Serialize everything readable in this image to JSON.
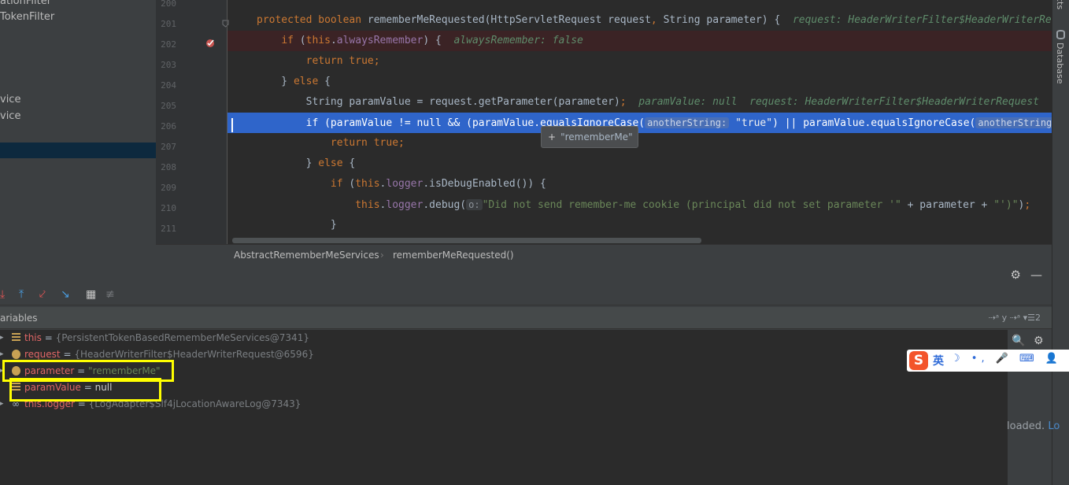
{
  "project_tree": {
    "items": [
      "ationFilter",
      "TokenFilter",
      "vice",
      "vice"
    ]
  },
  "editor": {
    "lines": [
      {
        "num": "200"
      },
      {
        "num": "201",
        "parts": [
          {
            "t": "protected boolean ",
            "c": "kw"
          },
          {
            "t": "rememberMeRequested(HttpServletRequest request",
            "c": ""
          },
          {
            "t": ", ",
            "c": "kw"
          },
          {
            "t": "String parameter) {  ",
            "c": ""
          },
          {
            "t": "request: HeaderWriterFilter$HeaderWriterRequest",
            "c": "hint"
          }
        ]
      },
      {
        "num": "202",
        "parts": [
          {
            "t": "    ",
            "c": ""
          },
          {
            "t": "if ",
            "c": "kw"
          },
          {
            "t": "(",
            "c": ""
          },
          {
            "t": "this",
            "c": "kw"
          },
          {
            "t": ".",
            "c": ""
          },
          {
            "t": "alwaysRemember",
            "c": "fld"
          },
          {
            "t": ") {  ",
            "c": ""
          },
          {
            "t": "alwaysRemember: false",
            "c": "hint"
          }
        ]
      },
      {
        "num": "203",
        "parts": [
          {
            "t": "        ",
            "c": ""
          },
          {
            "t": "return true",
            "c": "kw"
          },
          {
            "t": ";",
            "c": "kw"
          }
        ]
      },
      {
        "num": "204",
        "parts": [
          {
            "t": "    } ",
            "c": ""
          },
          {
            "t": "else ",
            "c": "kw"
          },
          {
            "t": "{",
            "c": ""
          }
        ]
      },
      {
        "num": "205",
        "parts": [
          {
            "t": "        String paramValue = request.getParameter(parameter)",
            "c": ""
          },
          {
            "t": ";  ",
            "c": "kw"
          },
          {
            "t": "paramValue: null  request: HeaderWriterFilter$HeaderWriterRequest",
            "c": "hint"
          }
        ]
      },
      {
        "num": "206",
        "parts": [
          {
            "t": "        ",
            "c": ""
          },
          {
            "t": "if ",
            "c": "kw"
          },
          {
            "t": "(paramValue != ",
            "c": ""
          },
          {
            "t": "null ",
            "c": "kw"
          },
          {
            "t": "&& (paramValue.equalsIgnoreCase(",
            "c": ""
          },
          {
            "t": "anotherString:",
            "c": "hint-inline"
          },
          {
            "t": " ",
            "c": ""
          },
          {
            "t": "\"true\"",
            "c": "str"
          },
          {
            "t": ") || paramValue.equalsIgnoreCase(",
            "c": ""
          },
          {
            "t": "anotherString:",
            "c": "hint-inline"
          }
        ]
      },
      {
        "num": "207",
        "parts": [
          {
            "t": "            ",
            "c": ""
          },
          {
            "t": "return true",
            "c": "kw"
          },
          {
            "t": ";",
            "c": "kw"
          }
        ]
      },
      {
        "num": "208",
        "parts": [
          {
            "t": "        } ",
            "c": ""
          },
          {
            "t": "else ",
            "c": "kw"
          },
          {
            "t": "{",
            "c": ""
          }
        ]
      },
      {
        "num": "209",
        "parts": [
          {
            "t": "            ",
            "c": ""
          },
          {
            "t": "if ",
            "c": "kw"
          },
          {
            "t": "(",
            "c": ""
          },
          {
            "t": "this",
            "c": "kw"
          },
          {
            "t": ".",
            "c": ""
          },
          {
            "t": "logger",
            "c": "fld"
          },
          {
            "t": ".isDebugEnabled()) {",
            "c": ""
          }
        ]
      },
      {
        "num": "210",
        "parts": [
          {
            "t": "                ",
            "c": ""
          },
          {
            "t": "this",
            "c": "kw"
          },
          {
            "t": ".",
            "c": ""
          },
          {
            "t": "logger",
            "c": "fld"
          },
          {
            "t": ".debug(",
            "c": ""
          },
          {
            "t": "o:",
            "c": "hint-inline"
          },
          {
            "t": "\"Did not send remember-me cookie (principal did not set parameter '\" ",
            "c": "str"
          },
          {
            "t": "+ parameter + ",
            "c": ""
          },
          {
            "t": "\"')\"",
            "c": "str"
          },
          {
            "t": ")",
            "c": ""
          },
          {
            "t": ";",
            "c": "kw"
          }
        ]
      },
      {
        "num": "211",
        "parts": [
          {
            "t": "            }",
            "c": ""
          }
        ]
      }
    ],
    "popup": {
      "plus": "+",
      "value": "\"rememberMe\""
    }
  },
  "breadcrumb": {
    "class_name": "AbstractRememberMeServices",
    "separator": "›",
    "method_name": "rememberMeRequested()"
  },
  "right_strip": {
    "top_label": "cts",
    "database_label": "Database"
  },
  "debug": {
    "header_icons": {
      "settings": "⚙",
      "minimize": "—"
    },
    "toolbar_icons": [
      {
        "name": "step-into-icon",
        "glyph": "⤓",
        "color": "#e05555"
      },
      {
        "name": "step-out-icon",
        "glyph": "⤒",
        "color": "#4a9de0"
      },
      {
        "name": "drop-frame-icon",
        "glyph": "⤦",
        "color": "#e05555"
      },
      {
        "name": "run-to-cursor-icon",
        "glyph": "↘",
        "color": "#4a9de0"
      },
      {
        "name": "evaluate-expression-icon",
        "glyph": "▦",
        "color": "#c8c8c8"
      },
      {
        "name": "trace-stream-icon",
        "glyph": "≢",
        "color": "#6f7275"
      }
    ],
    "variables_title": "ariables",
    "variables_header_right": "⇢ᵃ y ⇢ᵃ  ▾☰2",
    "variables": [
      {
        "name": "this",
        "eq": " = ",
        "value": "{PersistentTokenBasedRememberMeServices@7341}",
        "kind": "obj",
        "icon": "field",
        "expandable": true
      },
      {
        "name": "request",
        "eq": " = ",
        "value": "{HeaderWriterFilter$HeaderWriterRequest@6596}",
        "kind": "obj",
        "icon": "param",
        "expandable": true
      },
      {
        "name": "parameter",
        "eq": " = ",
        "value": "\"rememberMe\"",
        "kind": "str",
        "icon": "param",
        "expandable": true
      },
      {
        "name": "paramValue",
        "eq": " = ",
        "value": "null",
        "kind": "null",
        "icon": "field",
        "expandable": false
      },
      {
        "name": "this.logger",
        "eq": " = ",
        "value": "{LogAdapter$Slf4jLocationAwareLog@7343}",
        "kind": "obj",
        "icon": "watch",
        "expandable": true
      }
    ],
    "side_icons": {
      "search": "🔍",
      "settings": "⚙"
    },
    "loaded_text": "loaded. ",
    "loaded_link": "Lo"
  },
  "ime": {
    "logo": "S",
    "mode": "英",
    "icons": "☽ •, 🎤 ⌨ 👤 👕 ▦"
  },
  "colors": {
    "execution_line": "#2f65ca",
    "breakpoint_line": "#3b2325",
    "highlight_box": "#ffff00"
  }
}
